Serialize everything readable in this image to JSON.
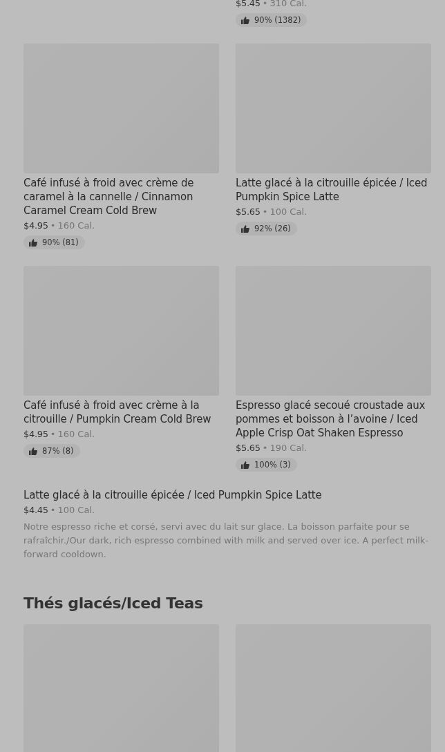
{
  "separator": "•",
  "top_item": {
    "price": "$5.45",
    "calories": "310 Cal.",
    "rating": "90% (1382)"
  },
  "items": [
    {
      "title": "Café infusé à froid avec crème de caramel à la cannelle / Cinnamon Caramel Cream Cold Brew",
      "price": "$4.95",
      "calories": "160 Cal.",
      "rating": "90% (81)"
    },
    {
      "title": "Latte glacé à la citrouille épicée / Iced Pumpkin Spice Latte",
      "price": "$5.65",
      "calories": "100 Cal.",
      "rating": "92% (26)"
    },
    {
      "title": "Café infusé à froid avec crème à la citrouille / Pumpkin Cream Cold Brew",
      "price": "$4.95",
      "calories": "160 Cal.",
      "rating": "87% (8)"
    },
    {
      "title": "Espresso glacé secoué croustade aux pommes et boisson à l’avoine / Iced Apple Crisp Oat Shaken Espresso",
      "price": "$5.65",
      "calories": "190 Cal.",
      "rating": "100% (3)"
    }
  ],
  "wide_item": {
    "title": "Latte glacé à la citrouille épicée / Iced Pumpkin Spice Latte",
    "price": "$4.45",
    "calories": "100 Cal.",
    "description": "Notre espresso riche et corsé, servi avec du lait sur glace. La boisson parfaite pour se rafraîchir./Our dark, rich espresso combined with milk and served over ice. A perfect milk-forward cooldown."
  },
  "section": {
    "title": "Thés glacés/Iced Teas",
    "items": [
      {
        "kind": "placeholder"
      },
      {
        "kind": "placeholder"
      }
    ]
  }
}
